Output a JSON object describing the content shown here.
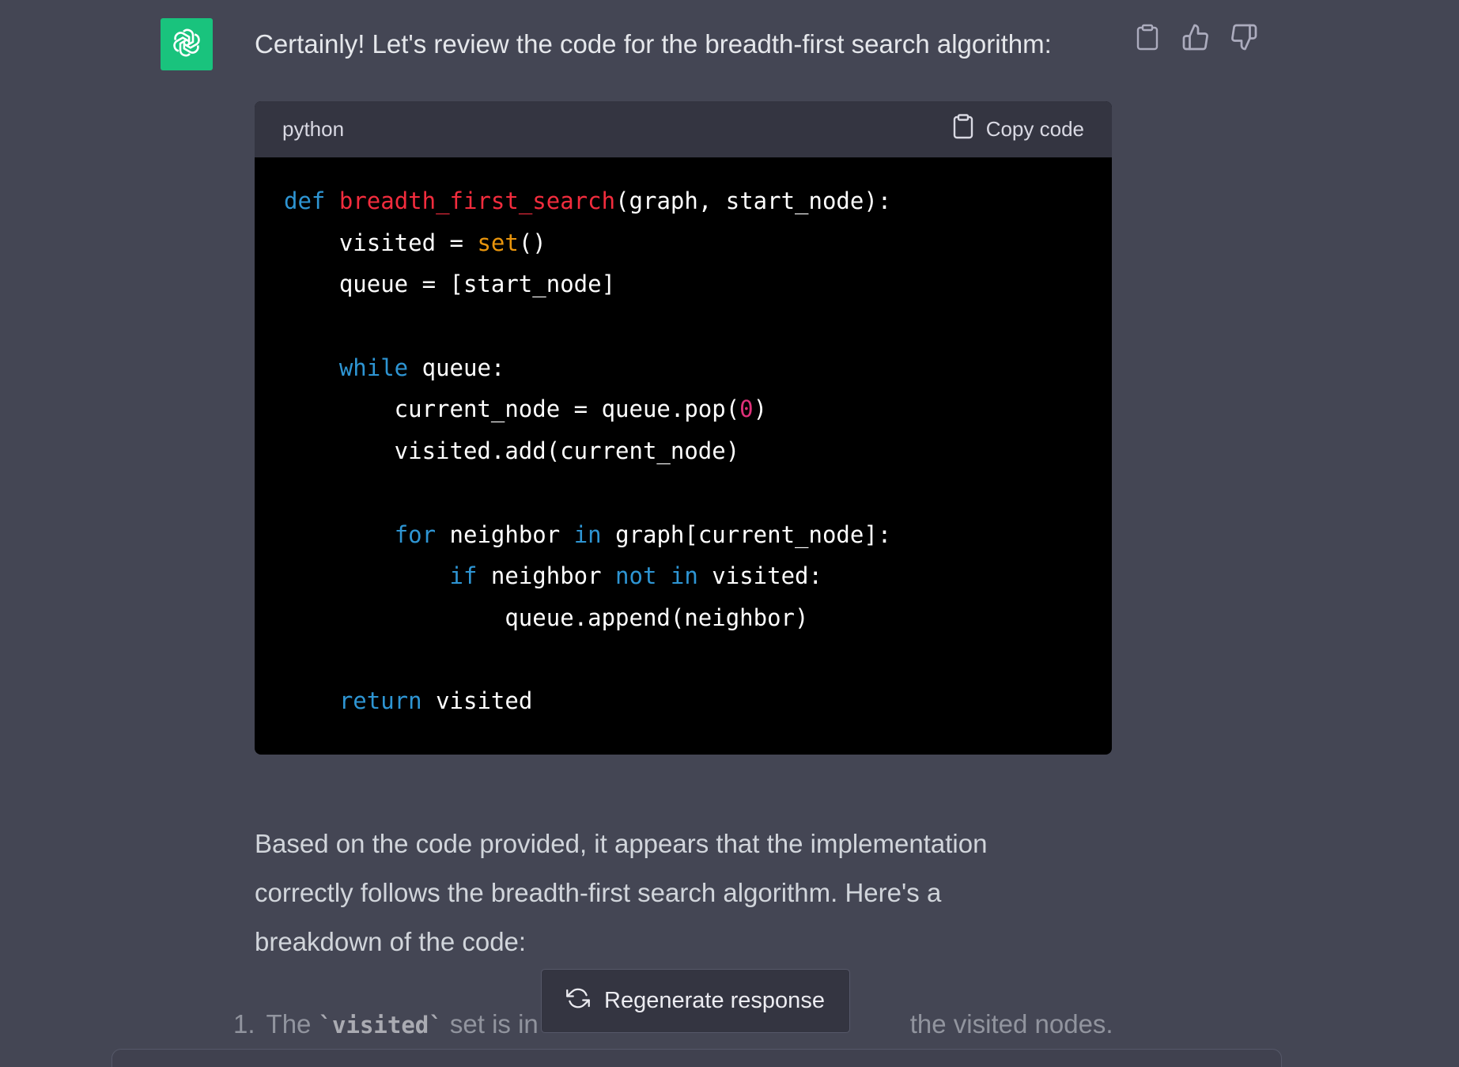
{
  "message": {
    "intro": "Certainly! Let's review the code for the breadth-first search algorithm:",
    "actions": [
      {
        "icon": "clipboard-icon"
      },
      {
        "icon": "thumbs-up-icon"
      },
      {
        "icon": "thumbs-down-icon"
      }
    ]
  },
  "code_block": {
    "language": "python",
    "copy_label": "Copy code",
    "lines": [
      [
        {
          "t": "def",
          "c": "kw"
        },
        {
          "t": " "
        },
        {
          "t": "breadth_first_search",
          "c": "fn"
        },
        {
          "t": "(graph, start_node):"
        }
      ],
      [
        {
          "t": "    visited = "
        },
        {
          "t": "set",
          "c": "bi"
        },
        {
          "t": "()"
        }
      ],
      [
        {
          "t": "    queue = [start_node]"
        }
      ],
      [
        {
          "t": ""
        }
      ],
      [
        {
          "t": "    "
        },
        {
          "t": "while",
          "c": "kw"
        },
        {
          "t": " queue:"
        }
      ],
      [
        {
          "t": "        current_node = queue.pop("
        },
        {
          "t": "0",
          "c": "num"
        },
        {
          "t": ")"
        }
      ],
      [
        {
          "t": "        visited.add(current_node)"
        }
      ],
      [
        {
          "t": ""
        }
      ],
      [
        {
          "t": "        "
        },
        {
          "t": "for",
          "c": "kw"
        },
        {
          "t": " neighbor "
        },
        {
          "t": "in",
          "c": "kw"
        },
        {
          "t": " graph[current_node]:"
        }
      ],
      [
        {
          "t": "            "
        },
        {
          "t": "if",
          "c": "kw"
        },
        {
          "t": " neighbor "
        },
        {
          "t": "not",
          "c": "kw"
        },
        {
          "t": " "
        },
        {
          "t": "in",
          "c": "kw"
        },
        {
          "t": " visited:"
        }
      ],
      [
        {
          "t": "                queue.append(neighbor)"
        }
      ],
      [
        {
          "t": ""
        }
      ],
      [
        {
          "t": "    "
        },
        {
          "t": "return",
          "c": "kw"
        },
        {
          "t": " visited"
        }
      ]
    ]
  },
  "paragraph": "Based on the code provided, it appears that the implementation correctly follows the breadth-first search algorithm. Here's a breakdown of the code:",
  "list_item": {
    "number": "1.",
    "prefix": "The ",
    "code": "`visited`",
    "middle": " set is in",
    "tail": "the visited nodes."
  },
  "regenerate_label": "Regenerate response",
  "colors": {
    "background": "#444654",
    "avatar": "#19c37d",
    "keyword": "#2e95d3",
    "function": "#f22c3d",
    "builtin": "#e9950c",
    "number": "#df3079"
  }
}
